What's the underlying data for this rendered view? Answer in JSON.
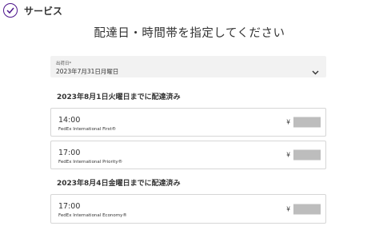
{
  "section": {
    "title": "サービス"
  },
  "page_title": "配達日・時間帯を指定してください",
  "date_select": {
    "label": "出荷日*",
    "value": "2023年7月31日月曜日"
  },
  "groups": [
    {
      "heading": "2023年8月1日火曜日までに配達済み",
      "options": [
        {
          "time": "14:00",
          "service": "FedEx International First®",
          "currency": "¥"
        },
        {
          "time": "17:00",
          "service": "FedEx International Priority®",
          "currency": "¥"
        }
      ]
    },
    {
      "heading": "2023年8月4日金曜日までに配達済み",
      "options": [
        {
          "time": "17:00",
          "service": "FedEx International Economy®",
          "currency": "¥"
        }
      ]
    }
  ],
  "colors": {
    "brand_purple": "#4d148c",
    "select_bg": "#f2f2f2",
    "card_border": "#d6d6d6",
    "price_mask": "#bdbdbd"
  },
  "icons": {
    "section_status": "check-circle-icon",
    "dropdown": "chevron-down-icon"
  }
}
